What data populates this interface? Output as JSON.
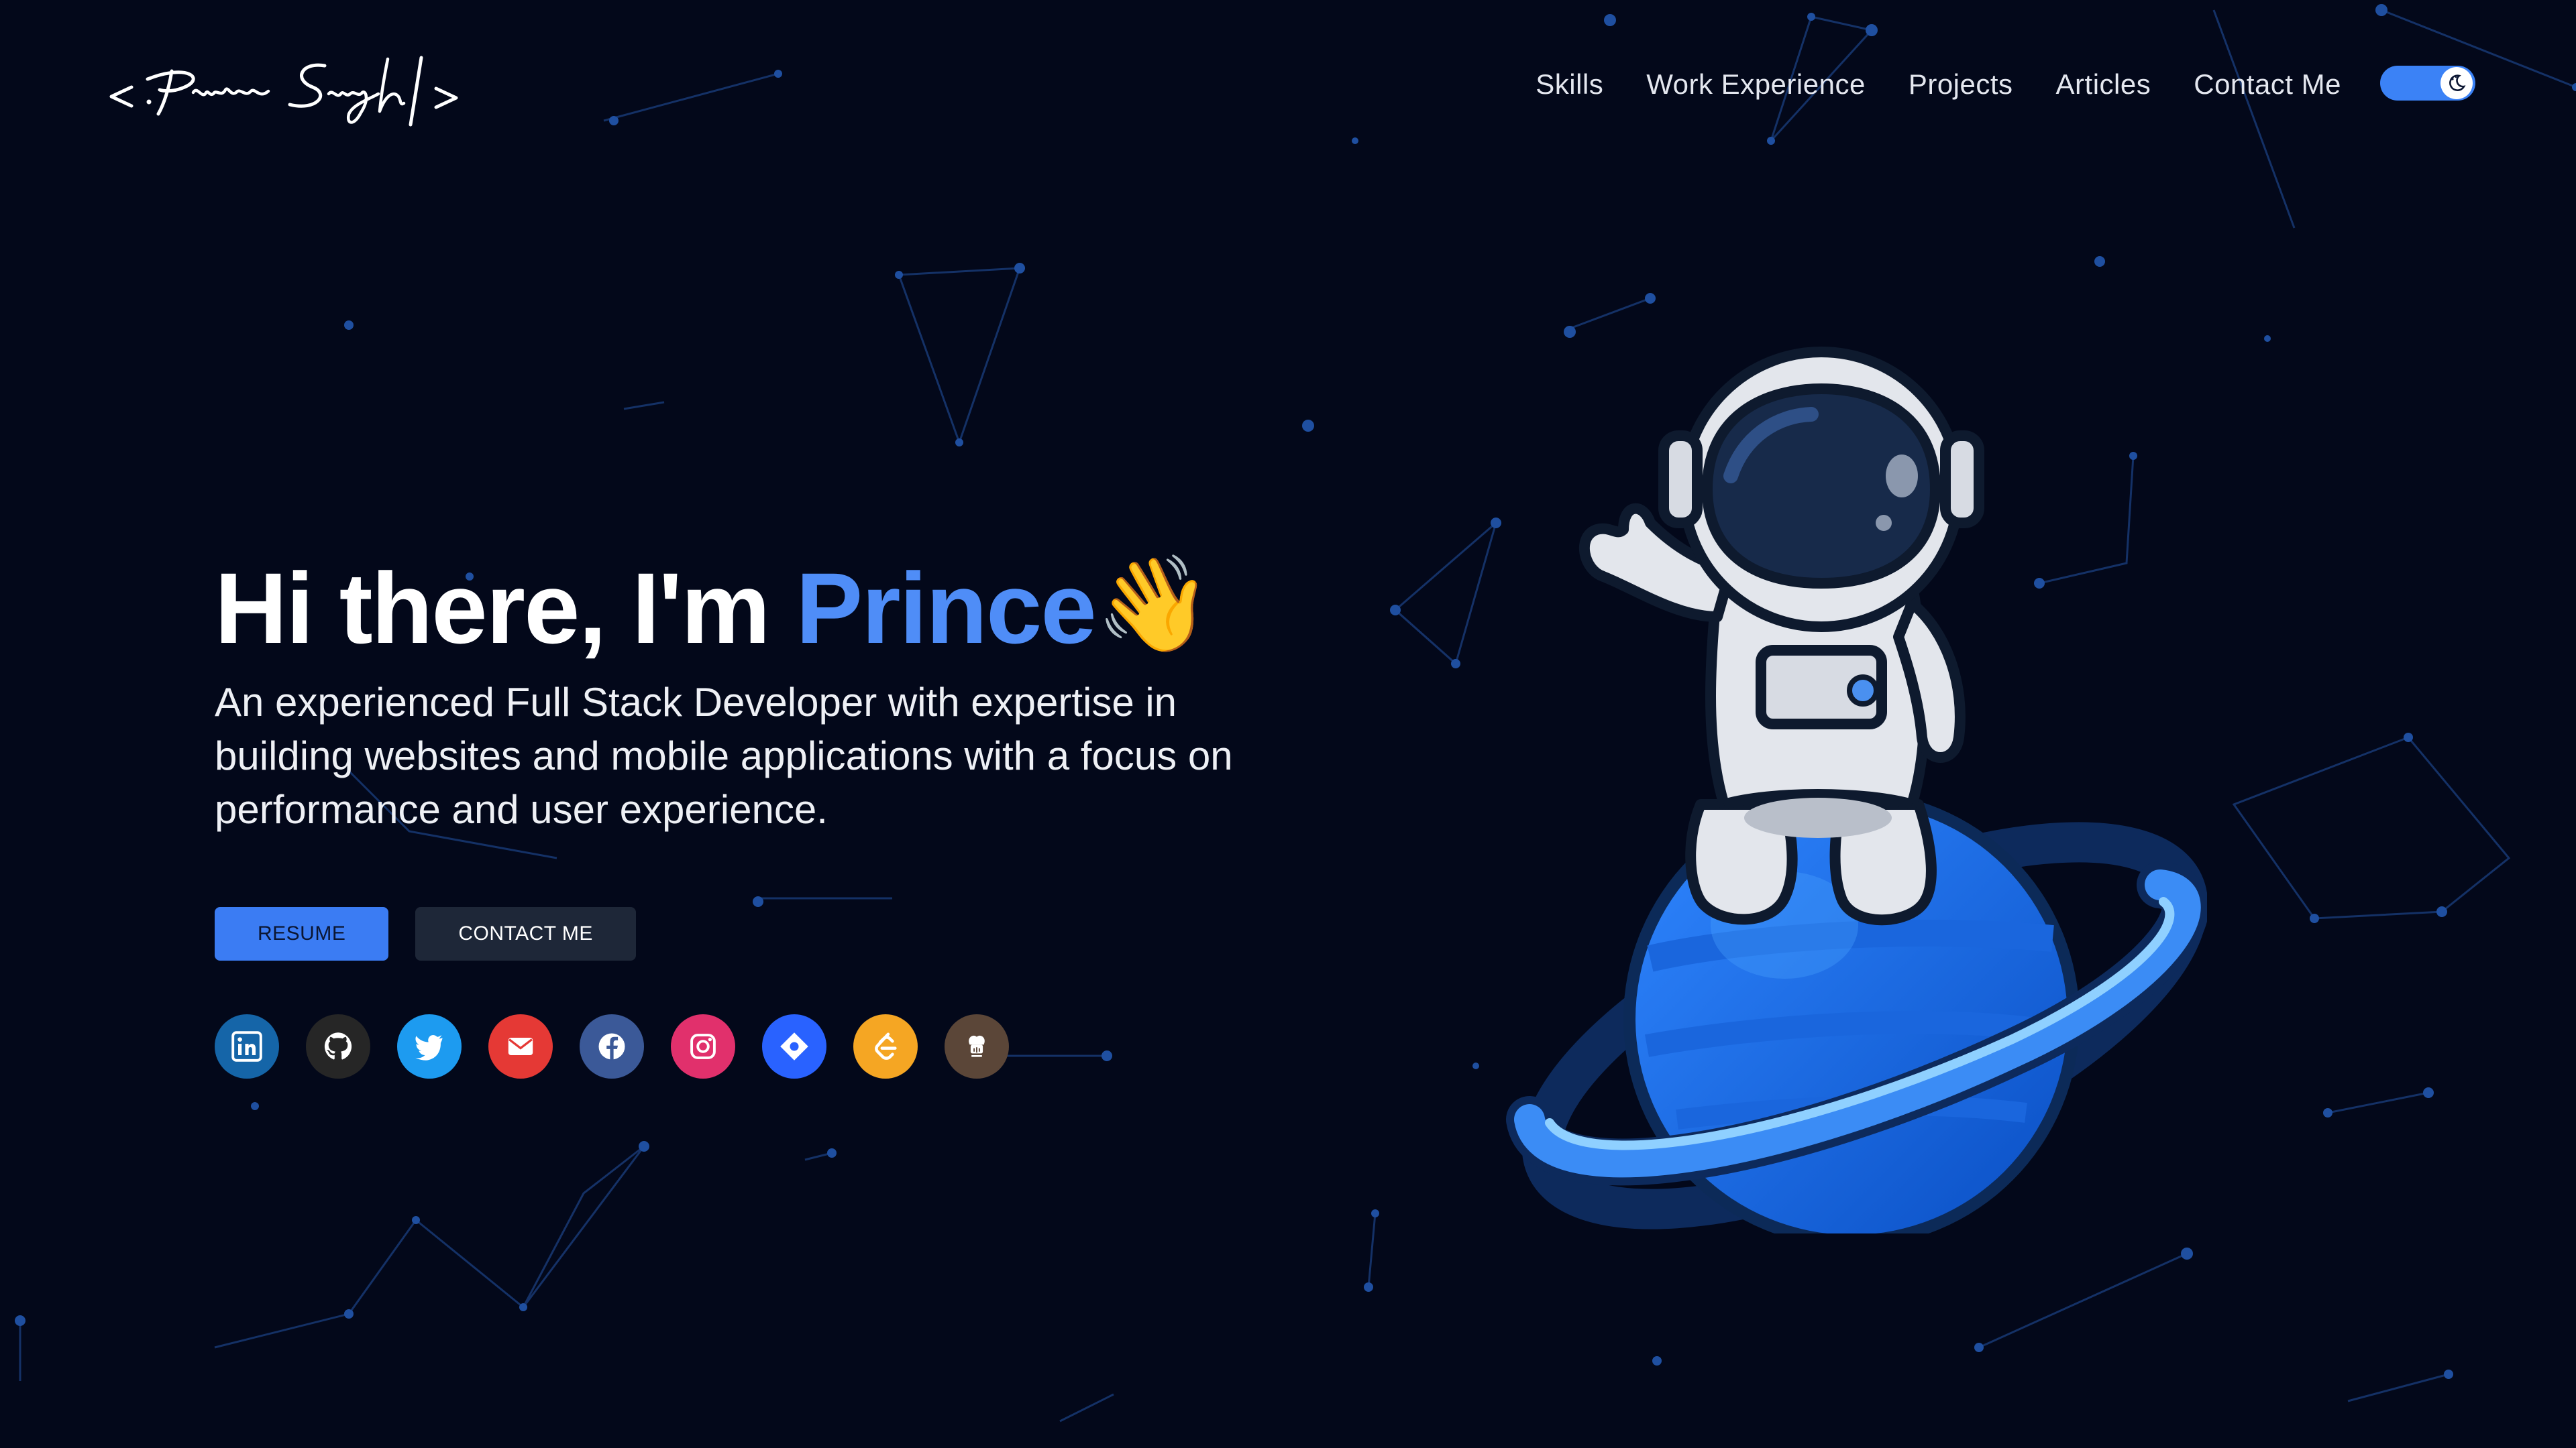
{
  "header": {
    "logo_text": "<Prince Singh/>",
    "nav": [
      {
        "label": "Skills"
      },
      {
        "label": "Work Experience"
      },
      {
        "label": "Projects"
      },
      {
        "label": "Articles"
      },
      {
        "label": "Contact Me"
      }
    ],
    "theme_toggle": {
      "state": "dark",
      "icon": "moon-icon"
    }
  },
  "hero": {
    "greeting": "Hi there, I'm ",
    "name": "Prince",
    "emoji": "👋",
    "description": "An experienced Full Stack Developer with expertise in building websites and mobile applications with a focus on performance and user experience."
  },
  "buttons": {
    "resume": "RESUME",
    "contact": "CONTACT ME"
  },
  "socials": [
    {
      "icon": "linkedin-icon",
      "color": "#1565a8"
    },
    {
      "icon": "github-icon",
      "color": "#262626"
    },
    {
      "icon": "twitter-icon",
      "color": "#1d9bf0"
    },
    {
      "icon": "email-icon",
      "color": "#e53935"
    },
    {
      "icon": "facebook-icon",
      "color": "#3b5998"
    },
    {
      "icon": "instagram-icon",
      "color": "#e1306c"
    },
    {
      "icon": "hashnode-icon",
      "color": "#2962ff"
    },
    {
      "icon": "leetcode-icon",
      "color": "#f5a623"
    },
    {
      "icon": "codechef-icon",
      "color": "#5b4638"
    }
  ],
  "colors": {
    "background": "#03081a",
    "accent": "#4f8df7",
    "network": "#2a5fb0"
  }
}
